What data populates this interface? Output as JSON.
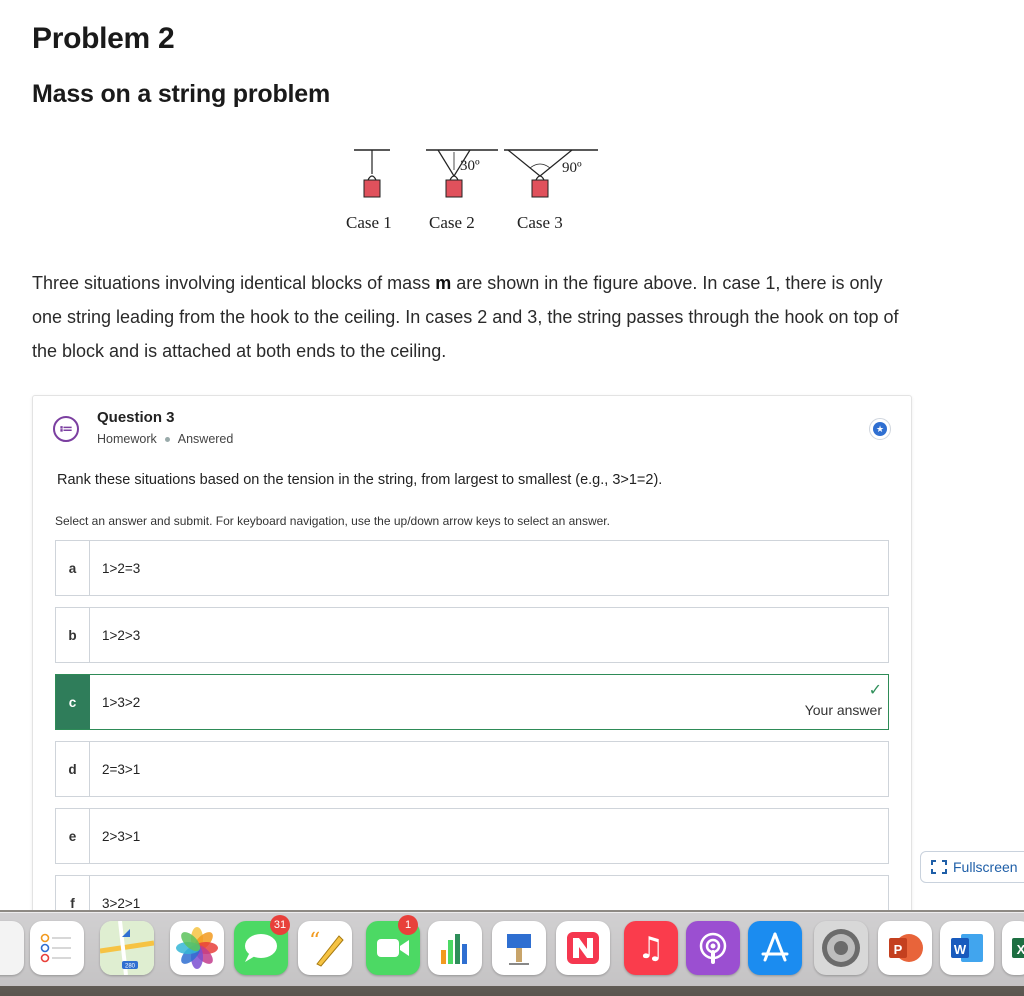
{
  "page": {
    "title": "Problem 2",
    "subtitle": "Mass on a string problem"
  },
  "figure": {
    "case1": "Case 1",
    "case2": "Case 2",
    "case3": "Case 3",
    "angle2": "30º",
    "angle3": "90º"
  },
  "intro": {
    "part1": "Three situations involving identical blocks of mass ",
    "mass_symbol": "m",
    "part2": " are shown in the figure above. In case 1, there is only one string leading from the hook to the ceiling. In cases 2 and 3, the string passes through the hook on top of the block and is attached at both ends to the ceiling."
  },
  "question": {
    "title": "Question 3",
    "type": "Homework",
    "status": "Answered",
    "prompt": "Rank these situations based on the tension in the string, from largest to smallest (e.g., 3>1=2).",
    "instructions": "Select an answer and submit. For keyboard navigation, use the up/down arrow keys to select an answer.",
    "answers": [
      {
        "letter": "a",
        "text": "1>2=3"
      },
      {
        "letter": "b",
        "text": "1>2>3"
      },
      {
        "letter": "c",
        "text": "1>3>2",
        "selected": true,
        "note": "Your answer"
      },
      {
        "letter": "d",
        "text": "2=3>1"
      },
      {
        "letter": "e",
        "text": "2>3>1"
      },
      {
        "letter": "f",
        "text": "3>2>1"
      }
    ]
  },
  "fullscreen_label": "Fullscreen",
  "dock": {
    "icons": [
      "reminders-icon",
      "maps-icon",
      "photos-icon",
      "messages-icon",
      "freeform-icon",
      "facetime-icon",
      "numbers-icon",
      "keynote-icon",
      "news-icon",
      "music-icon",
      "podcasts-icon",
      "app-store-icon",
      "system-settings-icon",
      "powerpoint-icon",
      "word-icon",
      "excel-icon"
    ],
    "messages_badge": "31",
    "facetime_badge": "1",
    "maps_label": "280"
  },
  "colors": {
    "selected_green": "#2f7d5a",
    "link_blue": "#1f5fa8",
    "block_red": "#e0515c"
  }
}
